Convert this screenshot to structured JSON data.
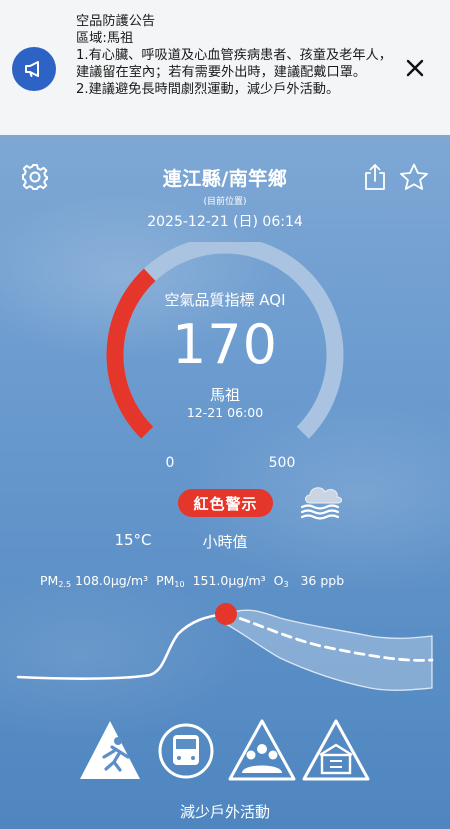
{
  "banner": {
    "title": "空品防護公告",
    "region": "區域:馬祖",
    "line1": "1.有心臟、呼吸道及心血管疾病患者、孩童及老年人，建議留在室內；若有需要外出時，建議配戴口罩。",
    "line2": "2.建議避免長時間劇烈運動，減少戶外活動。",
    "icon": "megaphone-icon",
    "close_icon": "close-icon"
  },
  "header": {
    "location": "連江縣/南竿鄉",
    "location_sub": "(目前位置)",
    "datetime": "2025-12-21 (日) 06:14",
    "settings_icon": "gear-icon",
    "share_icon": "share-icon",
    "favorite_icon": "star-icon"
  },
  "aqi": {
    "title": "空氣品質指標 AQI",
    "value": "170",
    "station": "馬祖",
    "time": "12-21 06:00",
    "scale_min": "0",
    "scale_max": "500",
    "level_fraction": 0.34,
    "level_color": "#e4362b",
    "track_color": "#a9c3e0"
  },
  "status": {
    "label": "紅色警示",
    "color": "#e4362b",
    "weather_icon": "haze-cloud-icon"
  },
  "readings": {
    "temperature": "15°C",
    "period": "小時值",
    "pm25_label": "PM",
    "pm25_sub": "2.5",
    "pm25_value": "108.0",
    "pm10_label": "PM",
    "pm10_sub": "10",
    "pm10_value": "151.0",
    "o3_label": "O",
    "o3_sub": "3",
    "o3_value": "36",
    "unit_ugm3": "μg/m³",
    "unit_ppb": "ppb"
  },
  "activities": {
    "icons": [
      "running-warning-icon",
      "bus-icon",
      "group-warning-icon",
      "outdoor-warning-icon"
    ],
    "advice": "減少戶外活動"
  }
}
